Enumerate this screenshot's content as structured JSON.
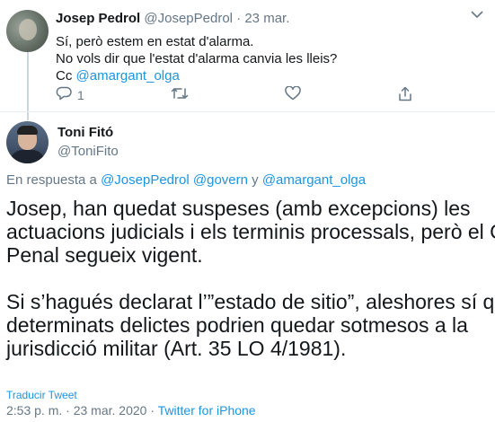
{
  "parent_tweet": {
    "name": "Josep Pedrol",
    "handle": "@JosepPedrol",
    "separator": "·",
    "date": "23 mar.",
    "lines": [
      "Sí, però estem en estat d'alarma.",
      "No vols dir que l'estat d'alarma canvia les lleis?"
    ],
    "cc_prefix": "Cc ",
    "cc_mention": "@amargant_olga",
    "reply_count": "1"
  },
  "main_tweet": {
    "name": "Toni Fitó",
    "handle": "@ToniFito",
    "reply_prefix": "En respuesta a ",
    "reply_mention_1": "@JosepPedrol",
    "reply_mention_2": "@govern",
    "reply_conj": " y ",
    "reply_mention_3": "@amargant_olga",
    "body_lines": [
      "Josep, han quedat suspeses (amb excepcions) les",
      "actuacions judicials i els terminis processals, però el C.",
      "Penal segueix vigent.",
      "",
      "Si s’hagués declarat l’”estado de sitio”, aleshores sí que",
      "determinats delictes podrien quedar sotmesos a la",
      "jurisdicció militar (Art. 35 LO 4/1981)."
    ],
    "translate": "Traducir Tweet",
    "time": "2:53 p. m.",
    "separator": "·",
    "date": "23 mar. 2020",
    "source": "Twitter for iPhone"
  }
}
